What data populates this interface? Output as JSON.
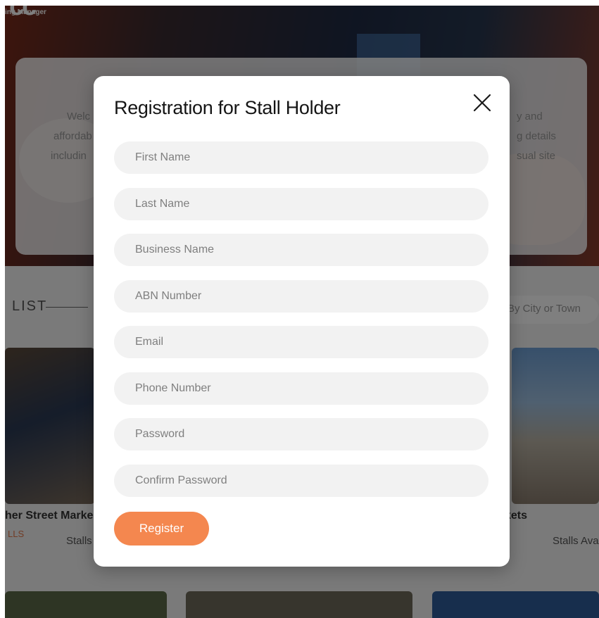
{
  "background": {
    "logo_mark": "cc",
    "logo_subtitle": "ing Manager",
    "intro_lines_left": [
      "Welc",
      "affordab",
      "includin"
    ],
    "intro_lines_right": [
      "y and",
      "g details",
      "sual site"
    ],
    "list_heading": "LIST",
    "city_search_placeholder": "By City or Town",
    "left_tile_caption": "her Street Marke",
    "left_tile_tag": "LLS",
    "left_tile_sub": "Stalls",
    "right_tile_caption": "kets",
    "right_tile_sub": "Stalls Ava"
  },
  "modal": {
    "title": "Registration for Stall Holder",
    "close_icon": "close-icon",
    "fields": [
      {
        "placeholder": "First Name",
        "value": ""
      },
      {
        "placeholder": "Last Name",
        "value": ""
      },
      {
        "placeholder": "Business Name",
        "value": ""
      },
      {
        "placeholder": "ABN Number",
        "value": ""
      },
      {
        "placeholder": "Email",
        "value": ""
      },
      {
        "placeholder": "Phone Number",
        "value": ""
      },
      {
        "placeholder": "Password",
        "value": ""
      },
      {
        "placeholder": "Confirm Password",
        "value": ""
      }
    ],
    "register_label": "Register"
  },
  "colors": {
    "accent": "#f4874f",
    "field_bg": "#f2f2f2",
    "overlay": "rgba(0,0,0,0.5)"
  }
}
